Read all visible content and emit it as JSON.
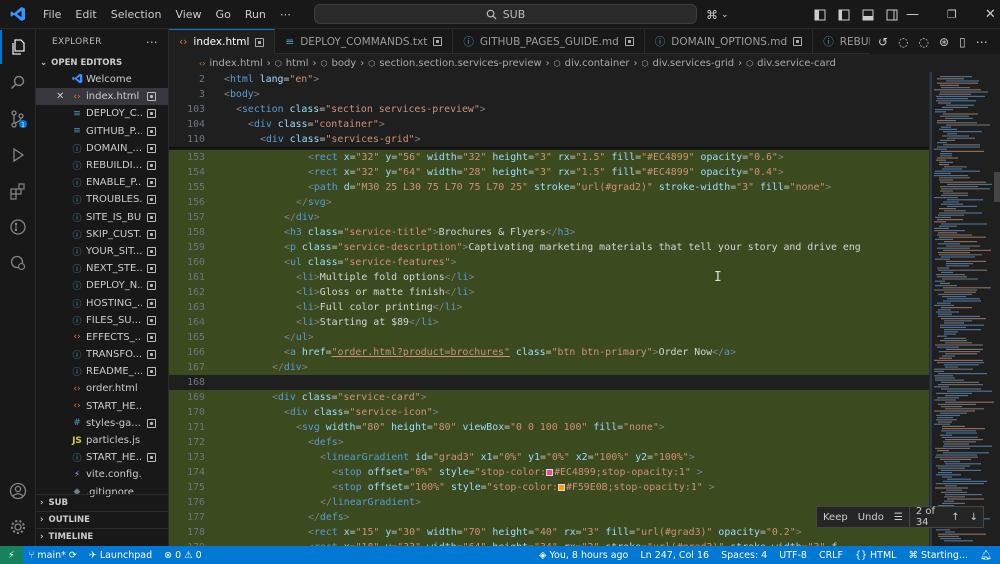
{
  "title_bar": {
    "menu": [
      "File",
      "Edit",
      "Selection",
      "View",
      "Go",
      "Run",
      "⋯"
    ],
    "search_placeholder": "SUB"
  },
  "explorer": {
    "header": "EXPLORER",
    "open_editors_label": "OPEN EDITORS",
    "files": [
      {
        "name": "Welcome",
        "icon": "vscode-icon",
        "icon_color": "#3794ff",
        "selected": false,
        "closable": false,
        "modified": false
      },
      {
        "name": "index.html",
        "icon": "html-icon",
        "icon_color": "#e37933",
        "selected": true,
        "closable": true,
        "modified": true
      },
      {
        "name": "DEPLOY_C...",
        "icon": "list-icon",
        "icon_color": "#519aba",
        "selected": false,
        "closable": false,
        "modified": true
      },
      {
        "name": "GITHUB_P...",
        "icon": "list-icon",
        "icon_color": "#519aba",
        "selected": false,
        "closable": false,
        "modified": true
      },
      {
        "name": "DOMAIN_...",
        "icon": "info-icon",
        "icon_color": "#519aba",
        "selected": false,
        "closable": false,
        "modified": true
      },
      {
        "name": "REBUILDI...",
        "icon": "info-icon",
        "icon_color": "#519aba",
        "selected": false,
        "closable": false,
        "modified": true
      },
      {
        "name": "ENABLE_P...",
        "icon": "info-icon",
        "icon_color": "#519aba",
        "selected": false,
        "closable": false,
        "modified": true
      },
      {
        "name": "TROUBLES...",
        "icon": "info-icon",
        "icon_color": "#519aba",
        "selected": false,
        "closable": false,
        "modified": true
      },
      {
        "name": "SITE_IS_BU...",
        "icon": "info-icon",
        "icon_color": "#519aba",
        "selected": false,
        "closable": false,
        "modified": true
      },
      {
        "name": "SKIP_CUST...",
        "icon": "info-icon",
        "icon_color": "#519aba",
        "selected": false,
        "closable": false,
        "modified": true
      },
      {
        "name": "YOUR_SIT...",
        "icon": "info-icon",
        "icon_color": "#519aba",
        "selected": false,
        "closable": false,
        "modified": true
      },
      {
        "name": "NEXT_STE...",
        "icon": "info-icon",
        "icon_color": "#519aba",
        "selected": false,
        "closable": false,
        "modified": true
      },
      {
        "name": "DEPLOY_N...",
        "icon": "info-icon",
        "icon_color": "#519aba",
        "selected": false,
        "closable": false,
        "modified": true
      },
      {
        "name": "HOSTING_...",
        "icon": "info-icon",
        "icon_color": "#519aba",
        "selected": false,
        "closable": false,
        "modified": true
      },
      {
        "name": "FILES_SU...",
        "icon": "info-icon",
        "icon_color": "#519aba",
        "selected": false,
        "closable": false,
        "modified": true
      },
      {
        "name": "EFFECTS_...",
        "icon": "html-icon",
        "icon_color": "#e37933",
        "selected": false,
        "closable": false,
        "modified": true
      },
      {
        "name": "TRANSFO...",
        "icon": "info-icon",
        "icon_color": "#519aba",
        "selected": false,
        "closable": false,
        "modified": true
      },
      {
        "name": "README_...",
        "icon": "info-icon",
        "icon_color": "#519aba",
        "selected": false,
        "closable": false,
        "modified": true
      },
      {
        "name": "order.html",
        "icon": "html-icon",
        "icon_color": "#e37933",
        "selected": false,
        "closable": false,
        "modified": false
      },
      {
        "name": "START_HE...",
        "icon": "html-icon",
        "icon_color": "#e37933",
        "selected": false,
        "closable": false,
        "modified": false
      },
      {
        "name": "styles-ga...",
        "icon": "hash-icon",
        "icon_color": "#519aba",
        "selected": false,
        "closable": false,
        "modified": true
      },
      {
        "name": "particles.js",
        "icon": "js-icon",
        "icon_color": "#cbcb41",
        "selected": false,
        "closable": false,
        "modified": false
      },
      {
        "name": "START_HE...",
        "icon": "info-icon",
        "icon_color": "#519aba",
        "selected": false,
        "closable": false,
        "modified": true
      },
      {
        "name": "vite.config.js",
        "icon": "vite-icon",
        "icon_color": "#bd93f9",
        "selected": false,
        "closable": false,
        "modified": false
      },
      {
        "name": ".gitignore",
        "icon": "git-icon",
        "icon_color": "#6d8086",
        "selected": false,
        "closable": false,
        "modified": false
      }
    ],
    "sections": [
      "SUB",
      "OUTLINE",
      "TIMELINE"
    ]
  },
  "tabs": [
    {
      "label": "index.html",
      "active": true,
      "icon": "html-icon"
    },
    {
      "label": "DEPLOY_COMMANDS.txt",
      "active": false,
      "icon": "list-icon"
    },
    {
      "label": "GITHUB_PAGES_GUIDE.md",
      "active": false,
      "icon": "info-icon"
    },
    {
      "label": "DOMAIN_OPTIONS.md",
      "active": false,
      "icon": "info-icon"
    },
    {
      "label": "REBUILD",
      "active": false,
      "icon": "info-icon"
    }
  ],
  "breadcrumbs": [
    "index.html",
    "html",
    "body",
    "section.section.services-preview",
    "div.container",
    "div.services-grid",
    "div.service-card"
  ],
  "editor": {
    "sticky_lines": [
      {
        "n": "2",
        "code": "<html lang=\"en\">"
      },
      {
        "n": "3",
        "code": "<body>"
      },
      {
        "n": "103",
        "code": "<section class=\"section services-preview\">"
      },
      {
        "n": "104",
        "code": "<div class=\"container\">"
      },
      {
        "n": "110",
        "code": "<div class=\"services-grid\">"
      }
    ],
    "lines": [
      {
        "n": "153",
        "indent": 14,
        "code": "<rect x=\"32\" y=\"56\" width=\"32\" height=\"3\" rx=\"1.5\" fill=\"#EC4899\" opacity=\"0.6\"/>"
      },
      {
        "n": "154",
        "indent": 14,
        "code": "<rect x=\"32\" y=\"64\" width=\"28\" height=\"3\" rx=\"1.5\" fill=\"#EC4899\" opacity=\"0.4\"/>"
      },
      {
        "n": "155",
        "indent": 14,
        "code": "<path d=\"M30 25 L30 75 L70 75 L70 25\" stroke=\"url(#grad2)\" stroke-width=\"3\" fill=\"none\"/>"
      },
      {
        "n": "156",
        "indent": 12,
        "code": "</svg>"
      },
      {
        "n": "157",
        "indent": 10,
        "code": "</div>"
      },
      {
        "n": "158",
        "indent": 10,
        "code": "<h3 class=\"service-title\">Brochures & Flyers</h3>"
      },
      {
        "n": "159",
        "indent": 10,
        "code": "<p class=\"service-description\">Captivating marketing materials that tell your story and drive eng"
      },
      {
        "n": "160",
        "indent": 10,
        "code": "<ul class=\"service-features\">"
      },
      {
        "n": "161",
        "indent": 12,
        "code": "<li>Multiple fold options</li>"
      },
      {
        "n": "162",
        "indent": 12,
        "code": "<li>Gloss or matte finish</li>"
      },
      {
        "n": "163",
        "indent": 12,
        "code": "<li>Full color printing</li>"
      },
      {
        "n": "164",
        "indent": 12,
        "code": "<li>Starting at $89</li>"
      },
      {
        "n": "165",
        "indent": 10,
        "code": "</ul>"
      },
      {
        "n": "166",
        "indent": 10,
        "code": "<a href=\"order.html?product=brochures\" class=\"btn btn-primary\">Order Now</a>"
      },
      {
        "n": "167",
        "indent": 8,
        "code": "</div>"
      },
      {
        "n": "168",
        "indent": 0,
        "code": ""
      },
      {
        "n": "169",
        "indent": 8,
        "code": "<div class=\"service-card\">"
      },
      {
        "n": "170",
        "indent": 10,
        "code": "<div class=\"service-icon\">"
      },
      {
        "n": "171",
        "indent": 12,
        "code": "<svg width=\"80\" height=\"80\" viewBox=\"0 0 100 100\" fill=\"none\">"
      },
      {
        "n": "172",
        "indent": 14,
        "code": "<defs>"
      },
      {
        "n": "173",
        "indent": 16,
        "code": "<linearGradient id=\"grad3\" x1=\"0%\" y1=\"0%\" x2=\"100%\" y2=\"100%\">"
      },
      {
        "n": "174",
        "indent": 18,
        "code": "<stop offset=\"0%\" style=\"stop-color:[#EC4899]#EC4899;stop-opacity:1\" />"
      },
      {
        "n": "175",
        "indent": 18,
        "code": "<stop offset=\"100%\" style=\"stop-color:[#F59E0B]#F59E0B;stop-opacity:1\" />"
      },
      {
        "n": "176",
        "indent": 16,
        "code": "</linearGradient>"
      },
      {
        "n": "177",
        "indent": 14,
        "code": "</defs>"
      },
      {
        "n": "178",
        "indent": 14,
        "code": "<rect x=\"15\" y=\"30\" width=\"70\" height=\"40\" rx=\"3\" fill=\"url(#grad3)\" opacity=\"0.2\"/>"
      },
      {
        "n": "179",
        "indent": 14,
        "code": "<rect x=\"18\" y=\"33\" width=\"64\" height=\"34\" rx=\"2\" stroke=\"url(#grad3)\" stroke-width=\"3\" f"
      }
    ]
  },
  "find_widget": {
    "keep": "Keep",
    "undo": "Undo",
    "count": "2 of 34"
  },
  "status_bar": {
    "branch": "main*",
    "launchpad": "Launchpad",
    "problems_errors": "0",
    "problems_warnings": "0",
    "blame": "You, 8 hours ago",
    "cursor": "Ln 247, Col 16",
    "indent": "Spaces: 4",
    "encoding": "UTF-8",
    "eol": "CRLF",
    "language": "HTML",
    "extension_status": "Starting..."
  },
  "colors": {
    "accent": "#0078d4",
    "diff_highlight": "#3b4a1f",
    "pink_swatch": "#EC4899",
    "amber_swatch": "#F59E0B"
  }
}
